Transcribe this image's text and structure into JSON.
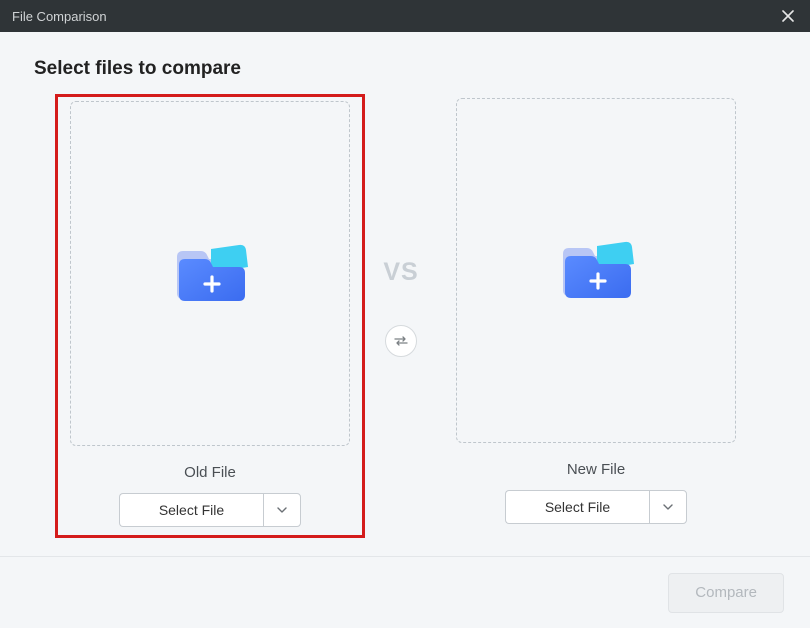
{
  "window": {
    "title": "File Comparison"
  },
  "heading": "Select files to compare",
  "middle": {
    "vs": "VS"
  },
  "old_file": {
    "label": "Old File",
    "select_label": "Select File",
    "highlighted": true
  },
  "new_file": {
    "label": "New File",
    "select_label": "Select File"
  },
  "footer": {
    "compare_label": "Compare",
    "compare_enabled": false
  }
}
